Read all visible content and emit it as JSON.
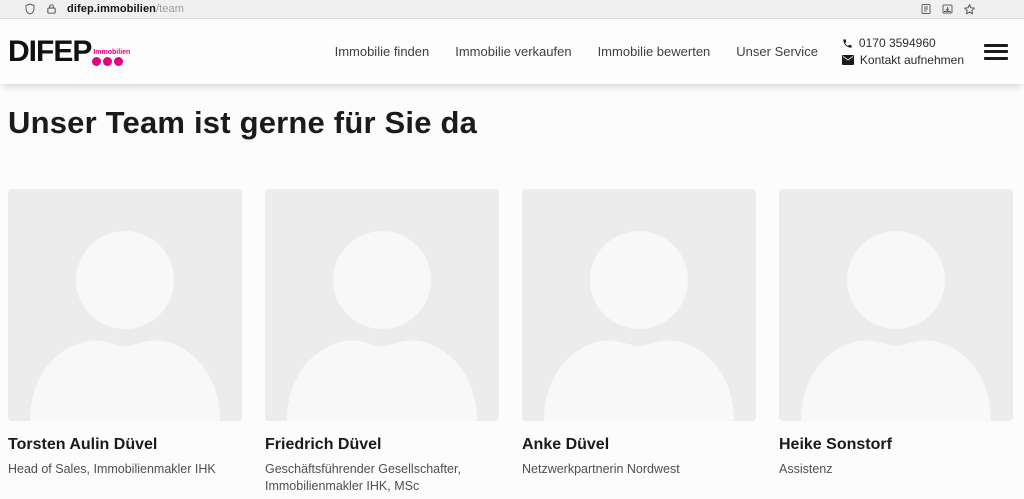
{
  "browser": {
    "url_domain": "difep.immobilien",
    "url_path": "/team"
  },
  "header": {
    "logo_text": "DIFEP",
    "logo_sub": "Immobilien",
    "nav": [
      {
        "label": "Immobilie finden"
      },
      {
        "label": "Immobilie verkaufen"
      },
      {
        "label": "Immobilie bewerten"
      },
      {
        "label": "Unser Service"
      }
    ],
    "phone": "0170 3594960",
    "contact_label": "Kontakt aufnehmen"
  },
  "main": {
    "title": "Unser Team ist gerne für Sie da",
    "team": [
      {
        "name": "Torsten Aulin Düvel",
        "role": "Head of Sales, Immobilienmakler IHK"
      },
      {
        "name": "Friedrich Düvel",
        "role": "Geschäftsführender Gesellschafter, Immobilienmakler IHK, MSc"
      },
      {
        "name": "Anke Düvel",
        "role": "Netzwerkpartnerin Nordwest"
      },
      {
        "name": "Heike Sonstorf",
        "role": "Assistenz"
      }
    ]
  },
  "colors": {
    "brand_pink": "#e6007e",
    "avatar_bg": "#ececec",
    "avatar_silhouette": "#f8f8f8",
    "urlbar_bg": "#f0f0f1"
  }
}
